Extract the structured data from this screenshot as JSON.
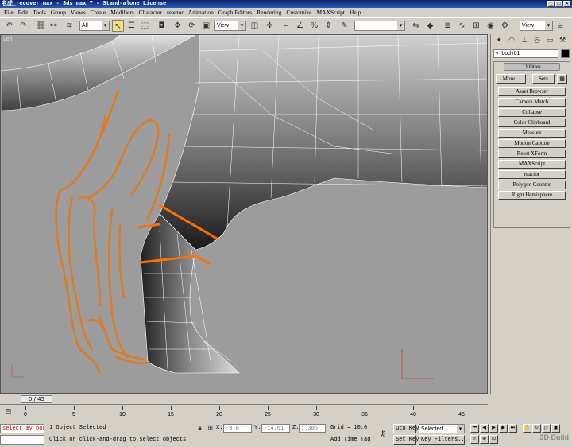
{
  "window": {
    "title": "老虎_recover.max - 3ds max 7  - Stand-alone License"
  },
  "menu": [
    "File",
    "Edit",
    "Tools",
    "Group",
    "Views",
    "Create",
    "Modifiers",
    "Character",
    "reactor",
    "Animation",
    "Graph Editors",
    "Rendering",
    "Customize",
    "MAXScript",
    "Help"
  ],
  "toolbar": {
    "selection_filter": "All",
    "coord_system": "View",
    "named_selection": "",
    "render_view": "View"
  },
  "viewport": {
    "label": "Left"
  },
  "command_panel": {
    "object_name": "v_body01",
    "object_color": "#000000",
    "utilities_title": "Utilities",
    "more_label": "More...",
    "sets_label": "Sets",
    "utilities": [
      "Asset Browser",
      "Camera Match",
      "Collapse",
      "Color Clipboard",
      "Measure",
      "Motion Capture",
      "Reset XForm",
      "MAXScript",
      "reactor",
      "Polygon Counter",
      "Right Hemisphere"
    ]
  },
  "timeline": {
    "slider_label": "0 / 45",
    "ticks": [
      "0",
      "5",
      "10",
      "15",
      "20",
      "25",
      "30",
      "35",
      "40",
      "45"
    ]
  },
  "status": {
    "listener": "select $v_bod",
    "selection_info": "1 Object Selected",
    "prompt": "Click or click-and-drag to select objects",
    "x_label": "X:",
    "x_value": "-0.0",
    "y_label": "Y:",
    "y_value": "-14.61",
    "z_label": "Z:",
    "z_value": "1.305",
    "grid": "Grid = 10.0",
    "add_time_tag": "Add Time Tag",
    "auto_key": "uto Key",
    "set_key": "Set Key",
    "key_mode": "Selected",
    "key_filters": "Key Filters...",
    "watermark": "3D Build"
  },
  "colors": {
    "viewport_bg": "#9c9c9c",
    "sketch_orange": "#e07a1e",
    "edge_highlight": "#ff7000"
  }
}
